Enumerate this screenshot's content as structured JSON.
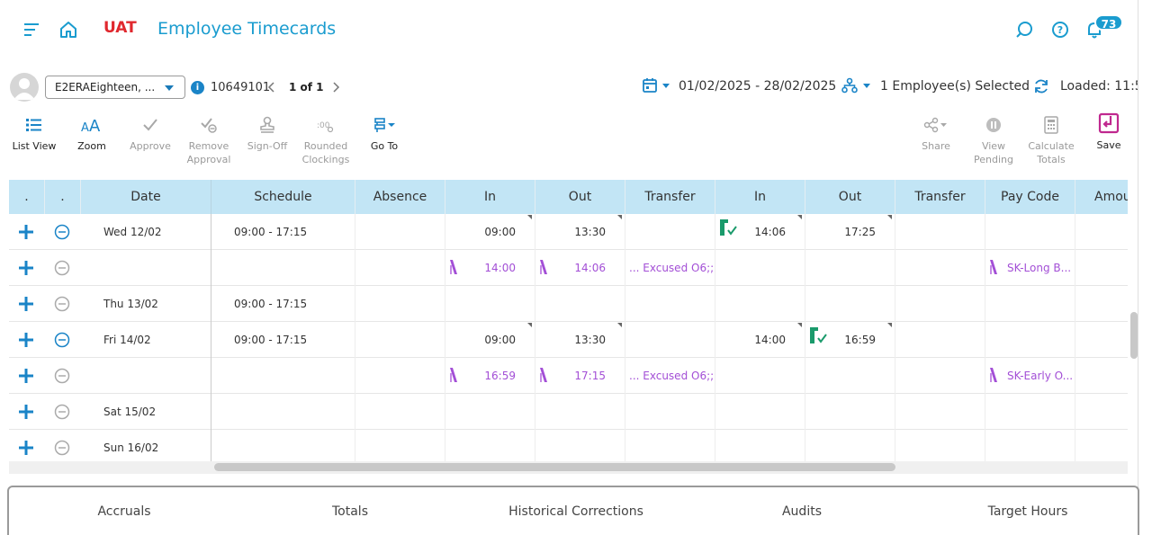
{
  "header": {
    "env_label": "UAT",
    "title": "Employee Timecards",
    "notification_count": "73"
  },
  "employee_bar": {
    "employee_name": "E2ERAEighteen, ...",
    "employee_id": "10649101",
    "pager": "1 of 1",
    "date_range": "01/02/2025 - 28/02/2025",
    "employees_selected": "1 Employee(s) Selected",
    "loaded_label": "Loaded: 11:5"
  },
  "toolbar": {
    "list_view": "List View",
    "zoom": "Zoom",
    "approve": "Approve",
    "remove_approval_1": "Remove",
    "remove_approval_2": "Approval",
    "sign_off": "Sign-Off",
    "rounded_1": "Rounded",
    "rounded_2": "Clockings",
    "go_to": "Go To",
    "share": "Share",
    "view_pending_1": "View",
    "view_pending_2": "Pending",
    "calc_totals_1": "Calculate",
    "calc_totals_2": "Totals",
    "save": "Save"
  },
  "grid": {
    "columns": {
      "c1": ".",
      "c2": ".",
      "date": "Date",
      "schedule": "Schedule",
      "absence": "Absence",
      "in1": "In",
      "out1": "Out",
      "transfer1": "Transfer",
      "in2": "In",
      "out2": "Out",
      "transfer2": "Transfer",
      "pay_code": "Pay Code",
      "amount": "Amoun"
    },
    "rows": [
      {
        "date": "Wed 12/02",
        "schedule": "09:00 - 17:15",
        "in1": "09:00",
        "out1": "13:30",
        "transfer1": "",
        "in2": "14:06",
        "out2": "17:25",
        "pay_code": ""
      },
      {
        "date": "",
        "schedule": "",
        "in1": "14:00",
        "out1": "14:06",
        "transfer1": "... Excused O6;;;",
        "in2": "",
        "out2": "",
        "pay_code": "SK-Long B..."
      },
      {
        "date": "Thu 13/02",
        "schedule": "09:00 - 17:15",
        "in1": "",
        "out1": "",
        "transfer1": "",
        "in2": "",
        "out2": "",
        "pay_code": ""
      },
      {
        "date": "Fri 14/02",
        "schedule": "09:00 - 17:15",
        "in1": "09:00",
        "out1": "13:30",
        "transfer1": "",
        "in2": "14:00",
        "out2": "16:59",
        "pay_code": ""
      },
      {
        "date": "",
        "schedule": "",
        "in1": "16:59",
        "out1": "17:15",
        "transfer1": "... Excused O6;;;",
        "in2": "",
        "out2": "",
        "pay_code": "SK-Early O..."
      },
      {
        "date": "Sat 15/02",
        "schedule": "",
        "in1": "",
        "out1": "",
        "transfer1": "",
        "in2": "",
        "out2": "",
        "pay_code": ""
      },
      {
        "date": "Sun 16/02",
        "schedule": "",
        "in1": "",
        "out1": "",
        "transfer1": "",
        "in2": "",
        "out2": "",
        "pay_code": ""
      }
    ]
  },
  "bottom_tabs": {
    "accruals": "Accruals",
    "totals": "Totals",
    "historical": "Historical Corrections",
    "audits": "Audits",
    "target_hours": "Target Hours"
  },
  "colors": {
    "accent": "#1a9ccf",
    "env": "#e0282e",
    "header_row": "#c2e5f5",
    "purple": "#a34fd6",
    "approved": "#1a9a6b"
  }
}
